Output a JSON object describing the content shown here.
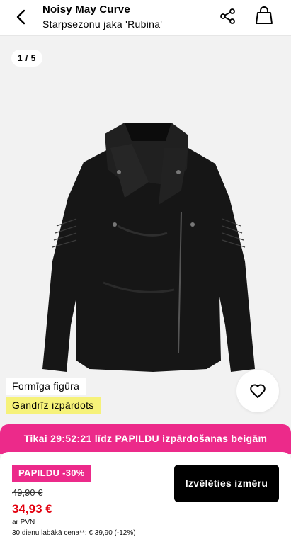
{
  "header": {
    "brand": "Noisy May Curve",
    "subtitle": "Starpsezonu jaka 'Rubina'"
  },
  "gallery": {
    "counter": "1 / 5"
  },
  "badges": {
    "figure": "Formīga figūra",
    "availability": "Gandrīz izpārdots"
  },
  "promo": {
    "text": "Tikai 29:52:21 līdz PAPILDU izpārdošanas beigām"
  },
  "pricing": {
    "discount_badge": "PAPILDU -30%",
    "old_price": "49,90 €",
    "new_price": "34,93 €",
    "vat_note": "ar PVN",
    "lowest_price_note": "30 dienu labākā cena**: € 39,90 (-12%)"
  },
  "actions": {
    "select_size": "Izvēlēties izmēru"
  },
  "colors": {
    "accent_pink": "#ec2a8a",
    "sale_red": "#e3000f",
    "soldout_yellow": "#f6f27a"
  },
  "icons": [
    "back-arrow-icon",
    "share-icon",
    "shopping-bag-icon",
    "heart-icon"
  ]
}
